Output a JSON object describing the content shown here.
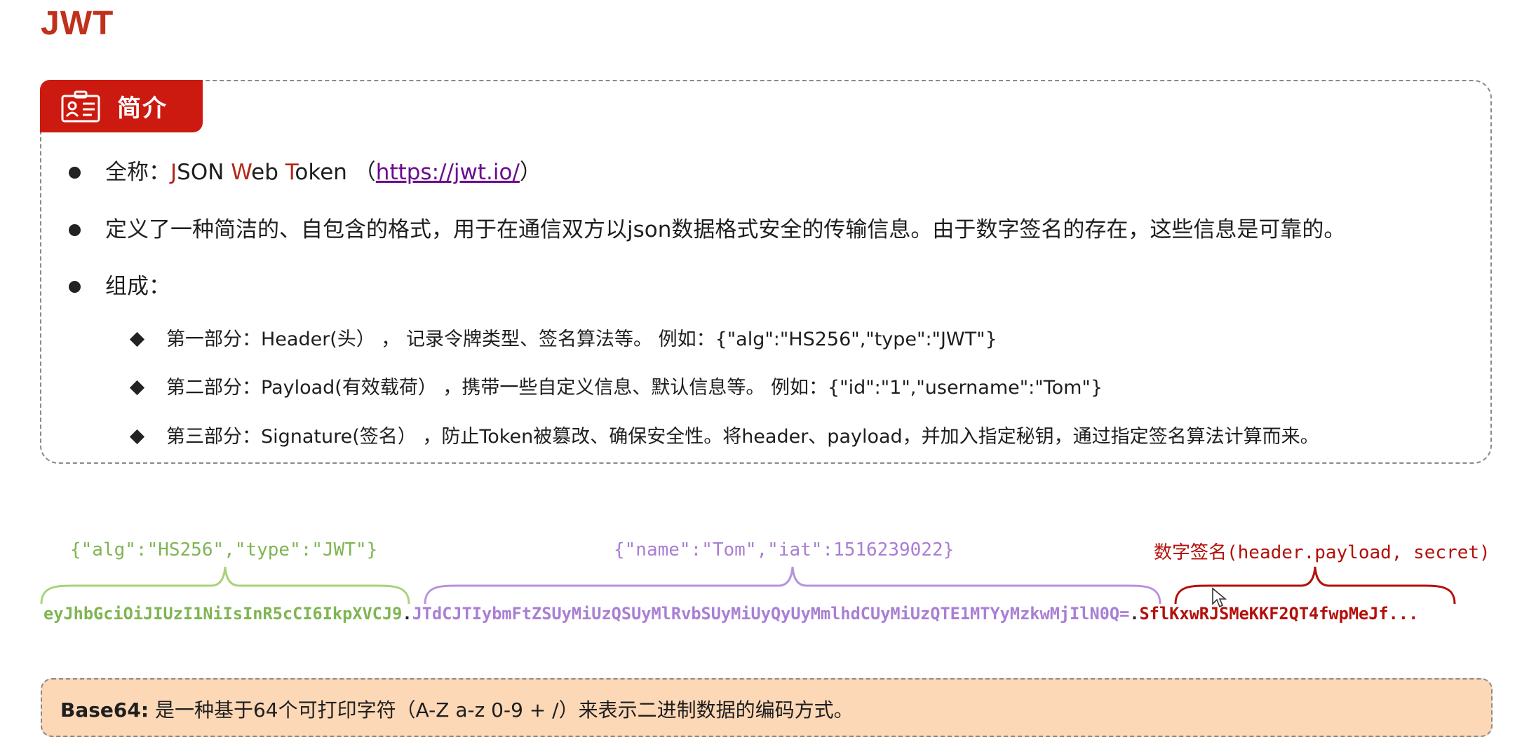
{
  "page": {
    "title": "JWT"
  },
  "intro": {
    "tag_label": "简介",
    "fullname": {
      "prefix": "全称：",
      "j": "J",
      "son": "SON ",
      "w": "W",
      "eb": "eb ",
      "t": "T",
      "oken": "oken （",
      "url": "https://jwt.io/",
      "close": "）"
    },
    "definition": "定义了一种简洁的、自包含的格式，用于在通信双方以json数据格式安全的传输信息。由于数字签名的存在，这些信息是可靠的。",
    "composition_label": "组成：",
    "parts": [
      "第一部分：Header(头） ，  记录令牌类型、签名算法等。 例如：{\"alg\":\"HS256\",\"type\":\"JWT\"}",
      "第二部分：Payload(有效载荷） ，携带一些自定义信息、默认信息等。 例如：{\"id\":\"1\",\"username\":\"Tom\"}",
      "第三部分：Signature(签名） ，防止Token被篡改、确保安全性。将header、payload，并加入指定秘钥，通过指定签名算法计算而来。"
    ]
  },
  "token_diagram": {
    "header_json": "{\"alg\":\"HS256\",\"type\":\"JWT\"}",
    "payload_json": "{\"name\":\"Tom\",\"iat\":1516239022}",
    "signature_label": "数字签名(header.payload, secret)",
    "header_encoded": "eyJhbGciOiJIUzI1NiIsInR5cCI6IkpXVCJ9",
    "dot": ".",
    "payload_encoded": "JTdCJTIybmFtZSUyMiUzQSUyMlRvbSUyMiUyQyUyMmlhdCUyMiUzQTE1MTYyMzkwMjIlN0Q=",
    "signature_encoded": "SflKxwRJSMeKKF2QT4fwpMeJf...",
    "colors": {
      "header": "#7fb552",
      "payload": "#a97fd4",
      "signature": "#b3100a"
    }
  },
  "base64_note": {
    "label": "Base64:",
    "text": " 是一种基于64个可打印字符（A-Z a-z 0-9 + /）来表示二进制数据的编码方式。"
  },
  "colors": {
    "accent": "#cc1a10",
    "note_bg": "#fdd8b7"
  }
}
